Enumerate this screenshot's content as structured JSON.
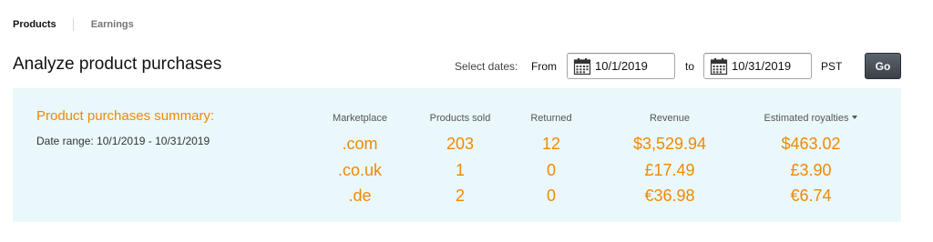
{
  "tabs": [
    {
      "label": "Products",
      "active": true
    },
    {
      "label": "Earnings",
      "active": false
    }
  ],
  "page_title": "Analyze product purchases",
  "date_controls": {
    "select_dates_label": "Select dates:",
    "from_label": "From",
    "from_value": "10/1/2019",
    "to_label": "to",
    "to_value": "10/31/2019",
    "timezone": "PST",
    "go_label": "Go",
    "calendar_icon": "calendar-icon"
  },
  "summary": {
    "title": "Product purchases summary:",
    "date_range": "Date range: 10/1/2019 - 10/31/2019",
    "columns": [
      "Marketplace",
      "Products sold",
      "Returned",
      "Revenue",
      "Estimated royalties"
    ],
    "rows": [
      {
        "marketplace": ".com",
        "products_sold": "203",
        "returned": "12",
        "revenue": "$3,529.94",
        "royalties": "$463.02"
      },
      {
        "marketplace": ".co.uk",
        "products_sold": "1",
        "returned": "0",
        "revenue": "£17.49",
        "royalties": "£3.90"
      },
      {
        "marketplace": ".de",
        "products_sold": "2",
        "returned": "0",
        "revenue": "€36.98",
        "royalties": "€6.74"
      }
    ]
  },
  "colors": {
    "accent_orange": "#f08804",
    "panel_background": "#eaf8fb",
    "go_button": "#3b4148"
  }
}
